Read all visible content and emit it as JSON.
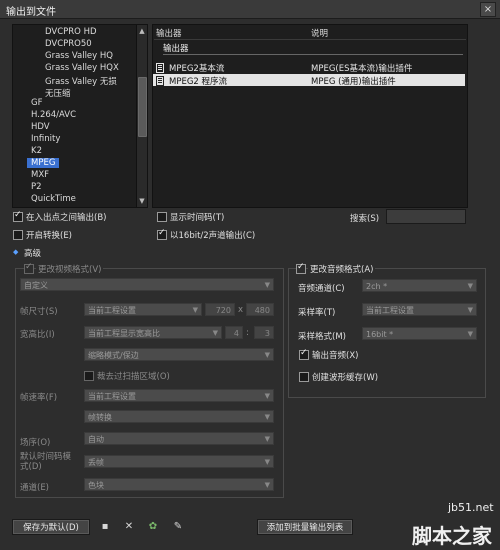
{
  "window": {
    "title": "输出到文件",
    "close": "×"
  },
  "tree": {
    "items": [
      {
        "label": "DVCPRO HD",
        "indent": 2
      },
      {
        "label": "DVCPRO50",
        "indent": 2
      },
      {
        "label": "Grass Valley HQ",
        "indent": 2
      },
      {
        "label": "Grass Valley HQX",
        "indent": 2
      },
      {
        "label": "Grass Valley 无损",
        "indent": 2
      },
      {
        "label": "无压缩",
        "indent": 2
      },
      {
        "label": "GF",
        "indent": 1
      },
      {
        "label": "H.264/AVC",
        "indent": 1
      },
      {
        "label": "HDV",
        "indent": 1
      },
      {
        "label": "Infinity",
        "indent": 1
      },
      {
        "label": "K2",
        "indent": 1
      },
      {
        "label": "MPEG",
        "indent": 1,
        "selected": true
      },
      {
        "label": "MXF",
        "indent": 1
      },
      {
        "label": "P2",
        "indent": 1
      },
      {
        "label": "QuickTime",
        "indent": 1
      }
    ]
  },
  "exporters": {
    "col_exporter": "输出器",
    "col_desc": "说明",
    "group_label": "输出器",
    "rows": [
      {
        "name": "MPEG2基本流",
        "desc": "MPEG(ES基本流)输出插件",
        "selected": false
      },
      {
        "name": "MPEG2 程序流",
        "desc": "MPEG (通用)输出插件",
        "selected": true
      }
    ]
  },
  "options": {
    "between_in_out": "在入出点之间输出(B)",
    "show_timecode": "显示时间码(T)",
    "enable_convert": "开启转换(E)",
    "output_16bit": "以16bit/2声道输出(C)",
    "search_label": "搜索(S)",
    "advanced": "高级"
  },
  "video": {
    "change_format": "更改视频格式(V)",
    "preset": "自定义",
    "frame_size_label": "帧尺寸(S)",
    "frame_size_value": "当前工程设置",
    "width": "720",
    "x": "x",
    "height": "480",
    "aspect_label": "宽高比(I)",
    "aspect_value": "当前工程显示宽高比",
    "aspect_a": "4",
    "colon": ":",
    "aspect_b": "3",
    "aspect_mode": "缩略模式/保边",
    "crop": "裁去过扫描区域(O)",
    "frame_rate_label": "帧速率(F)",
    "frame_rate_value": "当前工程设置",
    "frame_conv": "帧转换",
    "field_order_label": "场序(O)",
    "field_order_value": "自动",
    "timecode_label": "默认时间码模式(D)",
    "timecode_value": "丢帧",
    "channel_label": "通道(E)",
    "channel_value": "色块"
  },
  "audio": {
    "change_format": "更改音频格式(A)",
    "channels_label": "音频通道(C)",
    "channels_value": "2ch *",
    "rate_label": "采样率(T)",
    "rate_value": "当前工程设置",
    "format_label": "采样格式(M)",
    "format_value": "16bit *",
    "output_audio": "输出音频(X)",
    "waveform": "创建波形缓存(W)"
  },
  "footer": {
    "save_default": "保存为默认(D)",
    "add_batch": "添加到批量输出列表"
  },
  "watermark": {
    "site": "jb51.net",
    "brand": "脚本之家"
  }
}
